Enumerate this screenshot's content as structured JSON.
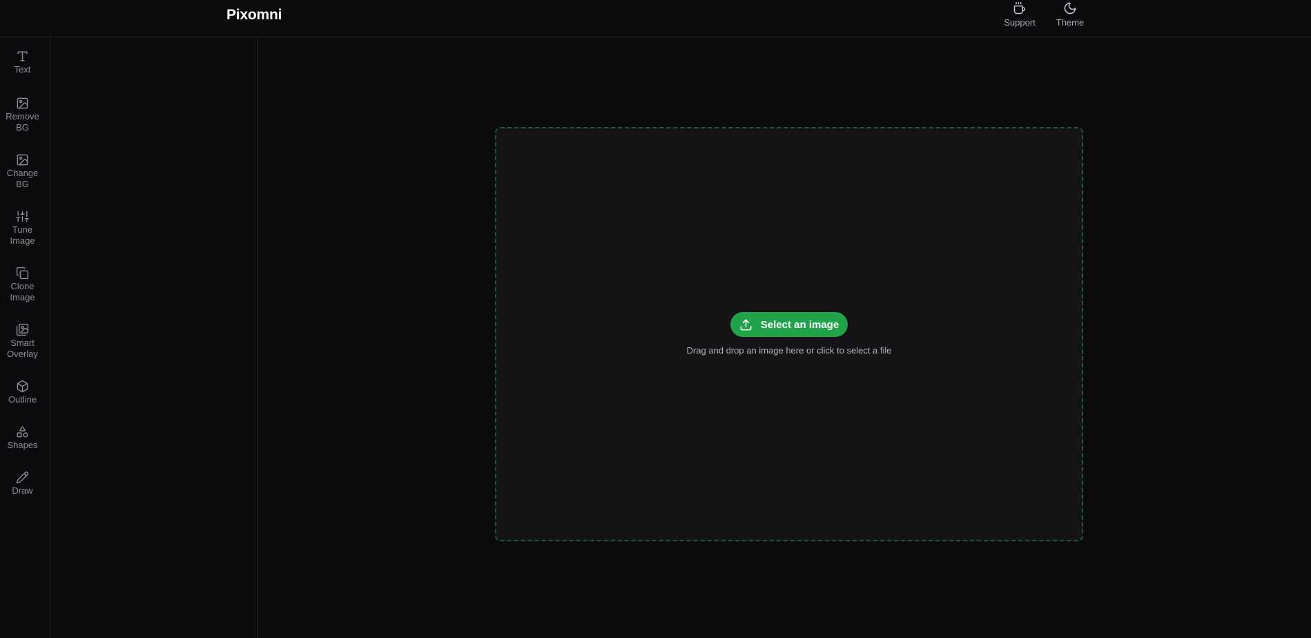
{
  "app": {
    "title": "Pixomni"
  },
  "header": {
    "actions": [
      {
        "label": "Support",
        "icon": "coffee-icon"
      },
      {
        "label": "Theme",
        "icon": "moon-icon"
      }
    ]
  },
  "sidebar": {
    "items": [
      {
        "label": "Text",
        "icon": "text-icon"
      },
      {
        "label": "Remove\nBG",
        "icon": "image-icon"
      },
      {
        "label": "Change\nBG",
        "icon": "image-icon"
      },
      {
        "label": "Tune\nImage",
        "icon": "sliders-icon"
      },
      {
        "label": "Clone\nImage",
        "icon": "copy-icon"
      },
      {
        "label": "Smart\nOverlay",
        "icon": "images-icon"
      },
      {
        "label": "Outline",
        "icon": "box-icon"
      },
      {
        "label": "Shapes",
        "icon": "shapes-icon"
      },
      {
        "label": "Draw",
        "icon": "pencil-icon"
      }
    ]
  },
  "dropzone": {
    "button_label": "Select an image",
    "button_icon": "upload-icon",
    "hint": "Drag and drop an image here or click to select a file"
  },
  "colors": {
    "background": "#0b0b0d",
    "dropzone_fill": "#141417",
    "dropzone_border": "#1f5a36",
    "accent": "#22a34a"
  }
}
